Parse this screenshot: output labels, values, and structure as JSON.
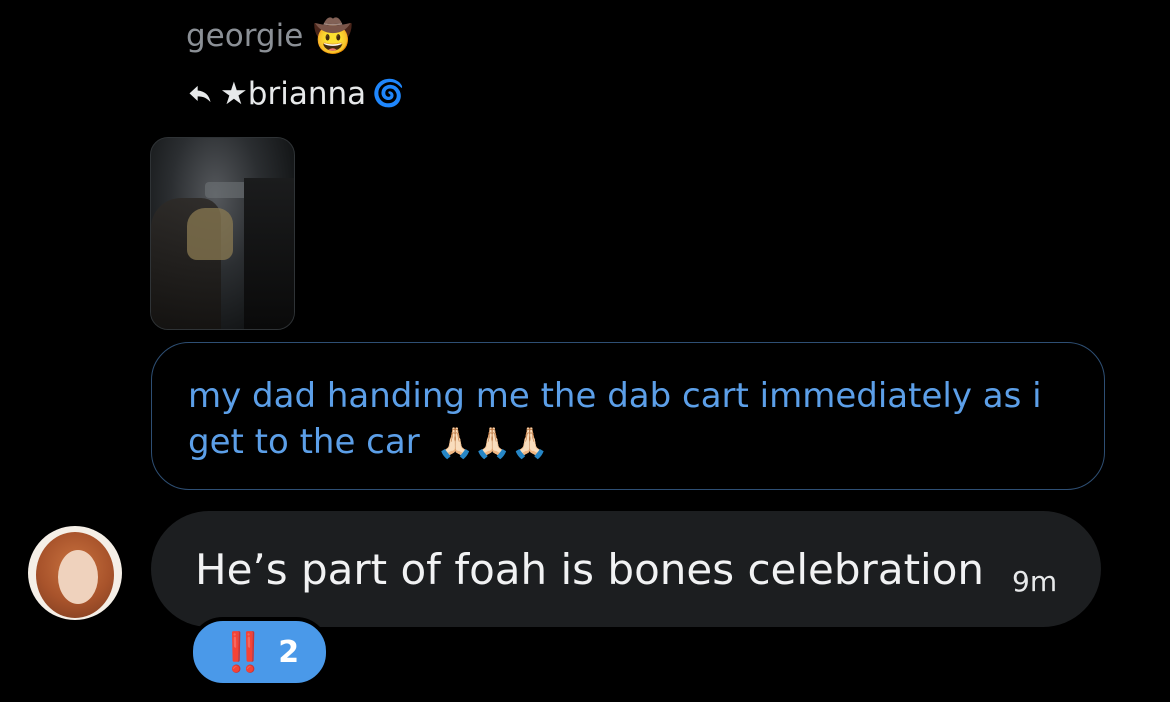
{
  "sender": {
    "name": "georgie",
    "emoji": "🤠"
  },
  "reply": {
    "to": "★brianna",
    "to_suffix": "🌀"
  },
  "media": {
    "alt": "photo"
  },
  "quoted_message": {
    "text": "my dad handing me the dab cart immediately as i get to the car",
    "emoji": "🙏🏻🙏🏻🙏🏻"
  },
  "message": {
    "text": "He’s part of foah is bones celebration",
    "time": "9m"
  },
  "reaction": {
    "emoji": "‼️",
    "count": "2"
  },
  "colors": {
    "accent": "#4a99e9",
    "quote_text": "#5c9fe8",
    "bubble": "#1c1e20"
  }
}
